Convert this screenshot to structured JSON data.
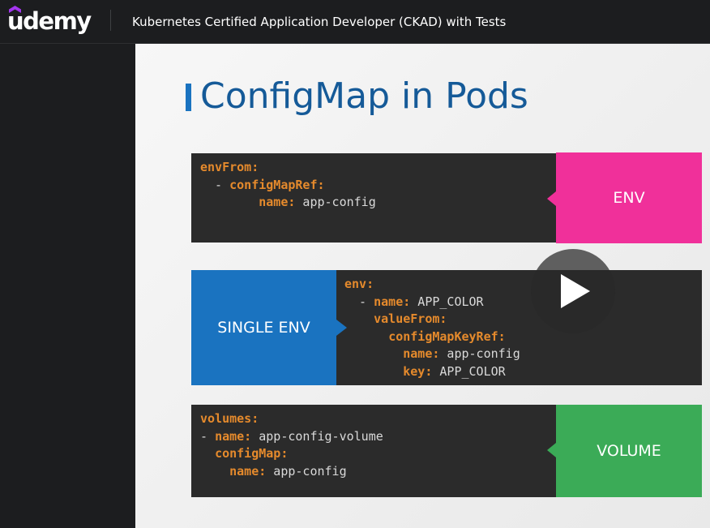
{
  "header": {
    "logo_text": "udemy",
    "course_title": "Kubernetes Certified Application Developer (CKAD) with Tests"
  },
  "slide": {
    "title": "ConfigMap in Pods",
    "panels": [
      {
        "tag": "ENV",
        "code": [
          [
            {
              "k": "envFrom:"
            }
          ],
          [
            {
              "t": "  - "
            },
            {
              "k": "configMapRef:"
            }
          ],
          [
            {
              "t": "        "
            },
            {
              "k": "name:"
            },
            {
              "t": " app-config"
            }
          ]
        ]
      },
      {
        "tag": "SINGLE ENV",
        "code": [
          [
            {
              "k": "env:"
            }
          ],
          [
            {
              "t": "  - "
            },
            {
              "k": "name:"
            },
            {
              "t": " APP_COLOR"
            }
          ],
          [
            {
              "t": "    "
            },
            {
              "k": "valueFrom:"
            }
          ],
          [
            {
              "t": "      "
            },
            {
              "k": "configMapKeyRef:"
            }
          ],
          [
            {
              "t": "        "
            },
            {
              "k": "name:"
            },
            {
              "t": " app-config"
            }
          ],
          [
            {
              "t": "        "
            },
            {
              "k": "key:"
            },
            {
              "t": " APP_COLOR"
            }
          ]
        ]
      },
      {
        "tag": "VOLUME",
        "code": [
          [
            {
              "k": "volumes:"
            }
          ],
          [
            {
              "t": "- "
            },
            {
              "k": "name:"
            },
            {
              "t": " app-config-volume"
            }
          ],
          [
            {
              "t": "  "
            },
            {
              "k": "configMap:"
            }
          ],
          [
            {
              "t": "    "
            },
            {
              "k": "name:"
            },
            {
              "t": " app-config"
            }
          ]
        ]
      }
    ]
  },
  "colors": {
    "env_tag": "#f0309a",
    "single_env_tag": "#1a73c0",
    "volume_tag": "#3bab57",
    "code_key": "#e58a2c",
    "title": "#155a98"
  },
  "icons": {
    "logo": "udemy-logo-icon",
    "play": "play-icon"
  }
}
